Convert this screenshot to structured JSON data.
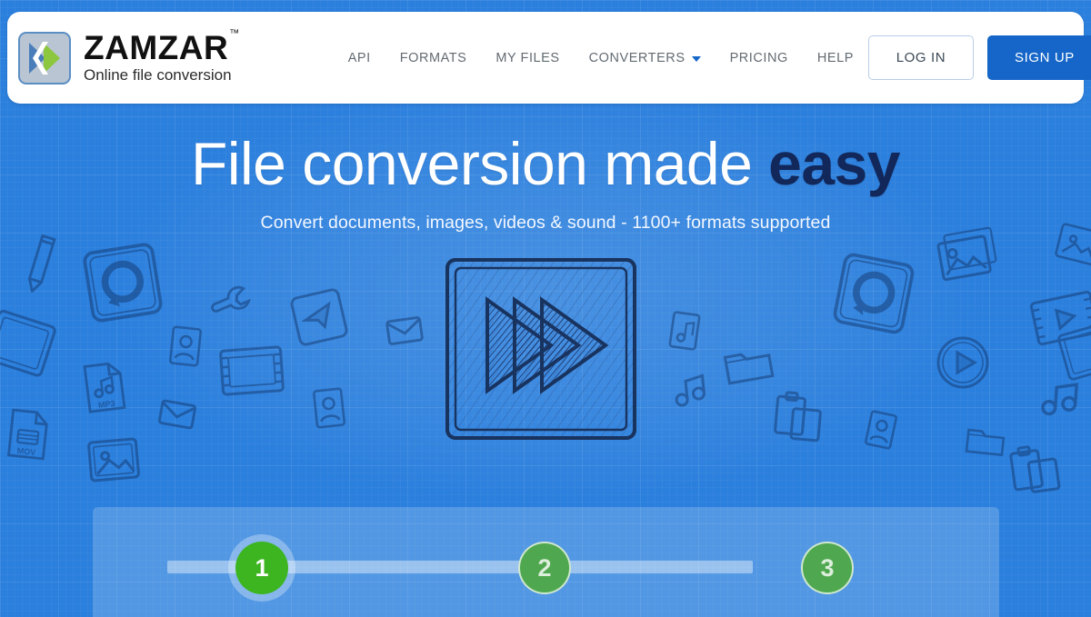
{
  "brand": {
    "name": "ZAMZAR",
    "trademark": "™",
    "tagline": "Online file conversion",
    "logo_icon": "double-chevron-icon",
    "logo_blue": "#4a7ebb",
    "logo_green": "#8dc63f"
  },
  "nav": {
    "items": [
      {
        "label": "API",
        "name": "nav-item-api",
        "caret": false
      },
      {
        "label": "FORMATS",
        "name": "nav-item-formats",
        "caret": false
      },
      {
        "label": "MY FILES",
        "name": "nav-item-my-files",
        "caret": false
      },
      {
        "label": "CONVERTERS",
        "name": "nav-item-converters",
        "caret": true
      },
      {
        "label": "PRICING",
        "name": "nav-item-pricing",
        "caret": false
      },
      {
        "label": "HELP",
        "name": "nav-item-help",
        "caret": false
      }
    ]
  },
  "auth": {
    "login_label": "LOG IN",
    "signup_label": "SIGN UP",
    "signup_color": "#1566c8"
  },
  "hero": {
    "title_light": "File conversion made ",
    "title_strong": "easy",
    "subtitle": "Convert documents, images, videos & sound - 1100+ formats supported",
    "graphic_icon": "fast-forward-sketch-icon",
    "background_color": "#2b7fdd"
  },
  "steps": {
    "items": [
      {
        "number": "1",
        "state": "active"
      },
      {
        "number": "2",
        "state": "inactive"
      },
      {
        "number": "3",
        "state": "inactive"
      }
    ],
    "active_color": "#3cb521",
    "inactive_color": "#4fa84f"
  },
  "doodles": [
    {
      "name": "pencil-icon"
    },
    {
      "name": "refresh-square-icon"
    },
    {
      "name": "wrench-icon"
    },
    {
      "name": "send-square-icon"
    },
    {
      "name": "envelope-icon"
    },
    {
      "name": "contact-card-icon"
    },
    {
      "name": "mp3-file-icon"
    },
    {
      "name": "mov-file-icon"
    },
    {
      "name": "image-file-icon"
    },
    {
      "name": "film-strip-icon"
    },
    {
      "name": "photos-stack-icon"
    },
    {
      "name": "play-circle-icon"
    },
    {
      "name": "music-note-icon"
    },
    {
      "name": "folder-icon"
    },
    {
      "name": "clipboard-icon"
    },
    {
      "name": "document-icon"
    }
  ]
}
